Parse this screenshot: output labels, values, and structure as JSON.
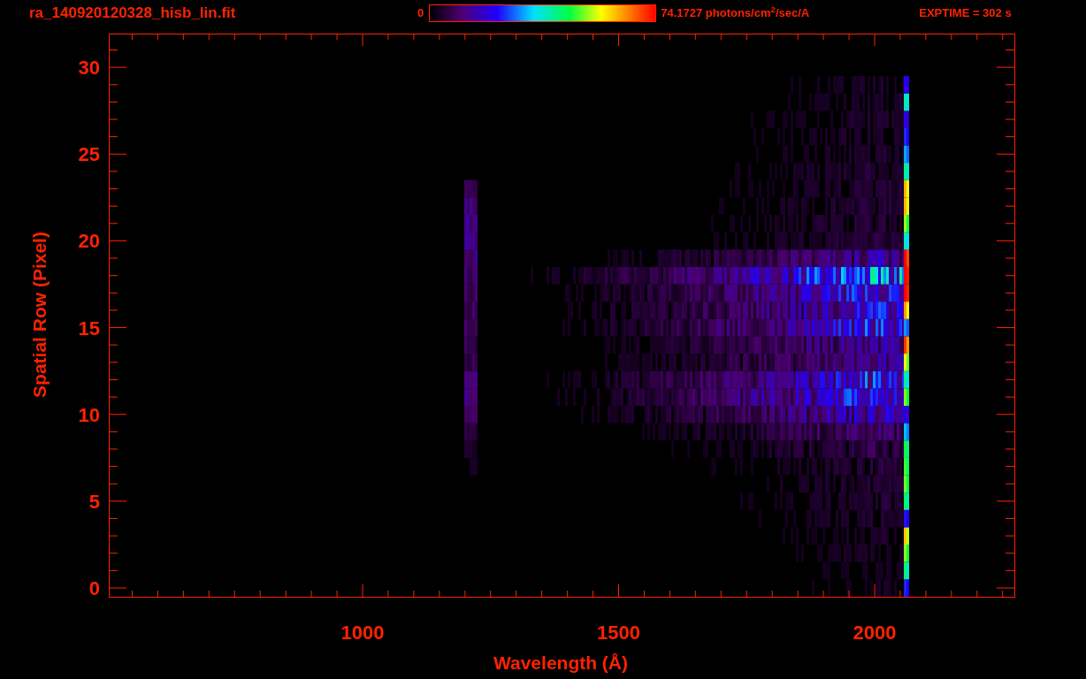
{
  "header": {
    "file_name": "ra_140920120328_hisb_lin.fit",
    "colorbar": {
      "min_label": "0",
      "max_label": "74.1727 photons/cm$^{2}$/sec/A"
    },
    "exposure": "EXPTIME = 302 s"
  },
  "plot": {
    "x_axis": {
      "label": "Wavelength (Å)",
      "ticks": [
        "1000",
        "1500",
        "2000"
      ]
    },
    "y_axis": {
      "label": "Spatial Row (Pixel)",
      "ticks": [
        "30",
        "25",
        "20",
        "15",
        "10",
        "5",
        "0"
      ]
    }
  }
}
